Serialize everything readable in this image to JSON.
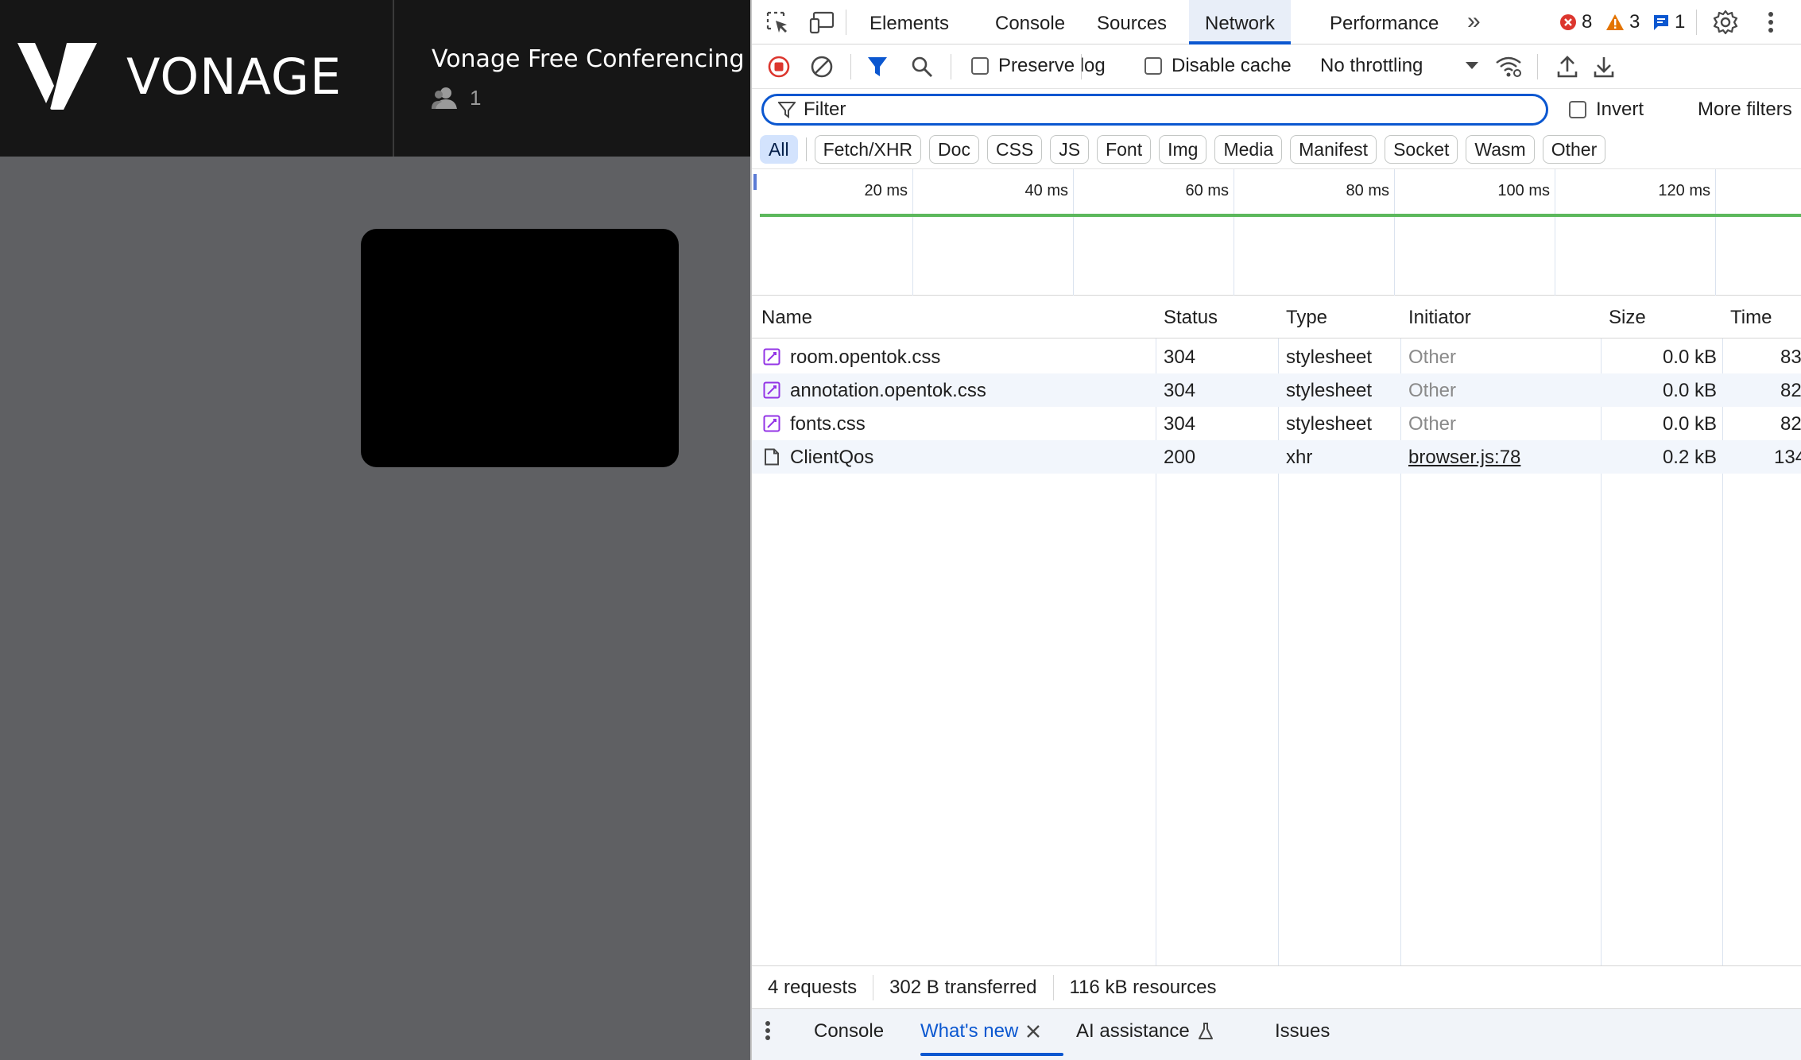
{
  "app": {
    "logo_text": "VONAGE",
    "room_title": "Vonage Free Conferencing",
    "participant_count": "1"
  },
  "devtools": {
    "tabs": [
      "Elements",
      "Console",
      "Sources",
      "Network",
      "Performance"
    ],
    "active_tab": "Network",
    "more_tabs": "»",
    "counters": {
      "errors": "8",
      "warnings": "3",
      "messages": "1"
    },
    "toolbar": {
      "preserve_log": "Preserve log",
      "disable_cache": "Disable cache",
      "throttling": "No throttling"
    },
    "filter": {
      "placeholder": "Filter",
      "invert": "Invert",
      "more_filters": "More filters"
    },
    "type_chips": [
      "All",
      "Fetch/XHR",
      "Doc",
      "CSS",
      "JS",
      "Font",
      "Img",
      "Media",
      "Manifest",
      "Socket",
      "Wasm",
      "Other"
    ],
    "timeline_ticks": [
      "20 ms",
      "40 ms",
      "60 ms",
      "80 ms",
      "100 ms",
      "120 ms"
    ],
    "columns": {
      "name": "Name",
      "status": "Status",
      "type": "Type",
      "initiator": "Initiator",
      "size": "Size",
      "time": "Time"
    },
    "requests": [
      {
        "name": "room.opentok.css",
        "status": "304",
        "type": "stylesheet",
        "initiator": "Other",
        "size": "0.0 kB",
        "time": "83",
        "icon": "stylesheet-icon"
      },
      {
        "name": "annotation.opentok.css",
        "status": "304",
        "type": "stylesheet",
        "initiator": "Other",
        "size": "0.0 kB",
        "time": "82",
        "icon": "stylesheet-icon"
      },
      {
        "name": "fonts.css",
        "status": "304",
        "type": "stylesheet",
        "initiator": "Other",
        "size": "0.0 kB",
        "time": "82",
        "icon": "stylesheet-icon"
      },
      {
        "name": "ClientQos",
        "status": "200",
        "type": "xhr",
        "initiator": "browser.js:78",
        "size": "0.2 kB",
        "time": "134",
        "icon": "document-icon"
      }
    ],
    "summary": {
      "requests": "4 requests",
      "transferred": "302 B transferred",
      "resources": "116 kB resources"
    },
    "drawer_tabs": {
      "console": "Console",
      "whats_new": "What's new",
      "ai": "AI assistance",
      "issues": "Issues"
    },
    "colors": {
      "accent": "#0b57d0",
      "error": "#dc362e",
      "warning": "#e37400",
      "stylesheet": "#9334e6"
    }
  }
}
